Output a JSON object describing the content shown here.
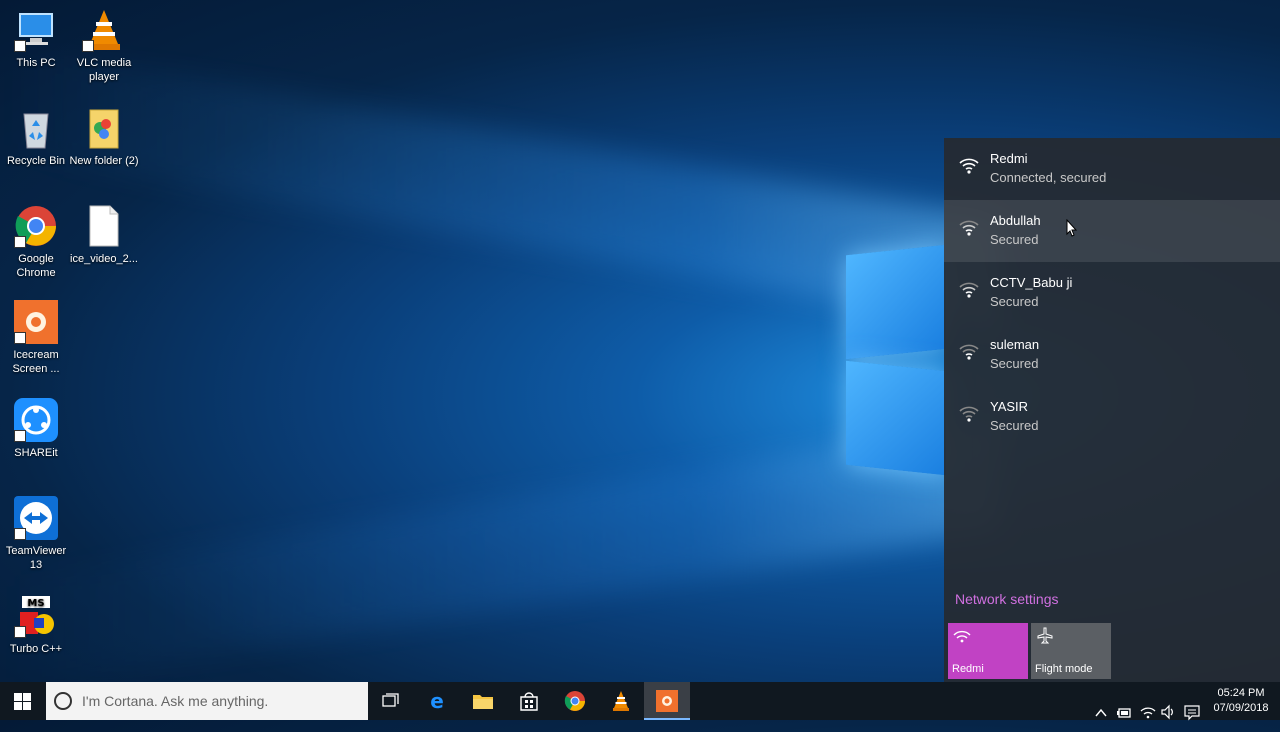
{
  "desktop": {
    "icons": [
      {
        "label": "This PC",
        "icon": "computer-icon"
      },
      {
        "label": "VLC media player",
        "icon": "vlc-icon"
      },
      {
        "label": "Recycle Bin",
        "icon": "recycle-bin-icon"
      },
      {
        "label": "New folder (2)",
        "icon": "folder-icon"
      },
      {
        "label": "Google Chrome",
        "icon": "chrome-icon"
      },
      {
        "label": "ice_video_2...",
        "icon": "file-icon"
      },
      {
        "label": "Icecream Screen ...",
        "icon": "icecream-icon"
      },
      {
        "label": "SHAREit",
        "icon": "shareit-icon"
      },
      {
        "label": "TeamViewer 13",
        "icon": "teamviewer-icon"
      },
      {
        "label": "Turbo C++",
        "icon": "turbo-cpp-icon"
      }
    ]
  },
  "network_flyout": {
    "networks": [
      {
        "name": "Redmi",
        "status": "Connected, secured"
      },
      {
        "name": "Abdullah",
        "status": "Secured"
      },
      {
        "name": "CCTV_Babu ji",
        "status": "Secured"
      },
      {
        "name": "suleman",
        "status": "Secured"
      },
      {
        "name": "YASIR",
        "status": "Secured"
      }
    ],
    "settings_link": "Network settings",
    "quick_actions": [
      {
        "label": "Redmi",
        "icon": "wifi-icon",
        "color": "#c142c4"
      },
      {
        "label": "Flight mode",
        "icon": "airplane-icon",
        "color": "#5b5f64"
      }
    ]
  },
  "taskbar": {
    "search_placeholder": "I'm Cortana. Ask me anything.",
    "apps": [
      "task-view-icon",
      "edge-icon",
      "file-explorer-icon",
      "store-icon",
      "chrome-icon",
      "vlc-icon",
      "icecream-icon"
    ],
    "clock": {
      "time": "05:24 PM",
      "date": "07/09/2018"
    }
  }
}
